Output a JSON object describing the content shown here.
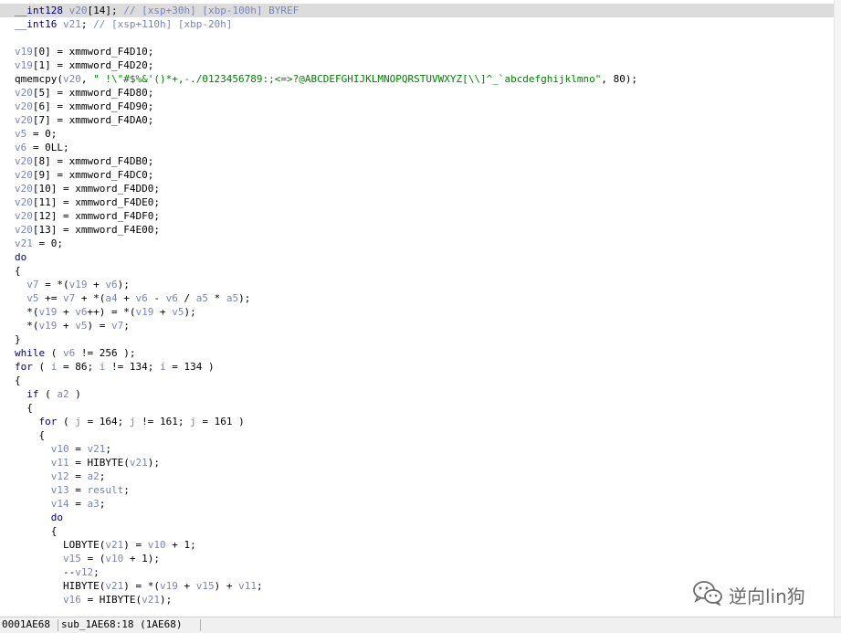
{
  "code_lines": [
    [
      [
        "__int128 ",
        "k"
      ],
      [
        "v20",
        "v"
      ],
      [
        "[14]; ",
        ""
      ],
      [
        "// [xsp+30h] [xbp-100h] BYREF",
        "c"
      ]
    ],
    [
      [
        "__int16 ",
        "k"
      ],
      [
        "v21",
        "v"
      ],
      [
        "; ",
        ""
      ],
      [
        "// [xsp+110h] [xbp-20h]",
        "c"
      ]
    ],
    [],
    [
      [
        "v19",
        "v"
      ],
      [
        "[0] = xmmword_F4D10;",
        ""
      ]
    ],
    [
      [
        "v19",
        "v"
      ],
      [
        "[1] = xmmword_F4D20;",
        ""
      ]
    ],
    [
      [
        "qmemcpy(",
        ""
      ],
      [
        "v20",
        "v"
      ],
      [
        ", ",
        ""
      ],
      [
        "\" !\\\"#$%&'()*+,-./0123456789:;<=>?@ABCDEFGHIJKLMNOPQRSTUVWXYZ[\\\\]^_`abcdefghijklmno\"",
        "str"
      ],
      [
        ", 80);",
        ""
      ]
    ],
    [
      [
        "v20",
        "v"
      ],
      [
        "[5] = xmmword_F4D80;",
        ""
      ]
    ],
    [
      [
        "v20",
        "v"
      ],
      [
        "[6] = xmmword_F4D90;",
        ""
      ]
    ],
    [
      [
        "v20",
        "v"
      ],
      [
        "[7] = xmmword_F4DA0;",
        ""
      ]
    ],
    [
      [
        "v5",
        "v"
      ],
      [
        " = 0;",
        ""
      ]
    ],
    [
      [
        "v6",
        "v"
      ],
      [
        " = 0LL;",
        ""
      ]
    ],
    [
      [
        "v20",
        "v"
      ],
      [
        "[8] = xmmword_F4DB0;",
        ""
      ]
    ],
    [
      [
        "v20",
        "v"
      ],
      [
        "[9] = xmmword_F4DC0;",
        ""
      ]
    ],
    [
      [
        "v20",
        "v"
      ],
      [
        "[10] = xmmword_F4DD0;",
        ""
      ]
    ],
    [
      [
        "v20",
        "v"
      ],
      [
        "[11] = xmmword_F4DE0;",
        ""
      ]
    ],
    [
      [
        "v20",
        "v"
      ],
      [
        "[12] = xmmword_F4DF0;",
        ""
      ]
    ],
    [
      [
        "v20",
        "v"
      ],
      [
        "[13] = xmmword_F4E00;",
        ""
      ]
    ],
    [
      [
        "v21",
        "v"
      ],
      [
        " = 0;",
        ""
      ]
    ],
    [
      [
        "do",
        "k"
      ]
    ],
    [
      [
        "{",
        ""
      ]
    ],
    [
      [
        "  ",
        ""
      ],
      [
        "v7",
        "v"
      ],
      [
        " = *(",
        ""
      ],
      [
        "v19",
        "v"
      ],
      [
        " + ",
        ""
      ],
      [
        "v6",
        "v"
      ],
      [
        ");",
        ""
      ]
    ],
    [
      [
        "  ",
        ""
      ],
      [
        "v5",
        "v"
      ],
      [
        " += ",
        ""
      ],
      [
        "v7",
        "v"
      ],
      [
        " + *(",
        ""
      ],
      [
        "a4",
        "v"
      ],
      [
        " + ",
        ""
      ],
      [
        "v6",
        "v"
      ],
      [
        " - ",
        ""
      ],
      [
        "v6",
        "v"
      ],
      [
        " / ",
        ""
      ],
      [
        "a5",
        "v"
      ],
      [
        " * ",
        ""
      ],
      [
        "a5",
        "v"
      ],
      [
        ");",
        ""
      ]
    ],
    [
      [
        "  *(",
        ""
      ],
      [
        "v19",
        "v"
      ],
      [
        " + ",
        ""
      ],
      [
        "v6",
        "v"
      ],
      [
        "++) = *(",
        ""
      ],
      [
        "v19",
        "v"
      ],
      [
        " + ",
        ""
      ],
      [
        "v5",
        "v"
      ],
      [
        ");",
        ""
      ]
    ],
    [
      [
        "  *(",
        ""
      ],
      [
        "v19",
        "v"
      ],
      [
        " + ",
        ""
      ],
      [
        "v5",
        "v"
      ],
      [
        ") = ",
        ""
      ],
      [
        "v7",
        "v"
      ],
      [
        ";",
        ""
      ]
    ],
    [
      [
        "}",
        ""
      ]
    ],
    [
      [
        "while",
        "k"
      ],
      [
        " ( ",
        ""
      ],
      [
        "v6",
        "v"
      ],
      [
        " != 256 );",
        ""
      ]
    ],
    [
      [
        "for",
        "k"
      ],
      [
        " ( ",
        ""
      ],
      [
        "i",
        "v"
      ],
      [
        " = 86; ",
        ""
      ],
      [
        "i",
        "v"
      ],
      [
        " != 134; ",
        ""
      ],
      [
        "i",
        "v"
      ],
      [
        " = 134 )",
        ""
      ]
    ],
    [
      [
        "{",
        ""
      ]
    ],
    [
      [
        "  ",
        ""
      ],
      [
        "if",
        "k"
      ],
      [
        " ( ",
        ""
      ],
      [
        "a2",
        "v"
      ],
      [
        " )",
        ""
      ]
    ],
    [
      [
        "  {",
        ""
      ]
    ],
    [
      [
        "    ",
        ""
      ],
      [
        "for",
        "k"
      ],
      [
        " ( ",
        ""
      ],
      [
        "j",
        "v"
      ],
      [
        " = 164; ",
        ""
      ],
      [
        "j",
        "v"
      ],
      [
        " != 161; ",
        ""
      ],
      [
        "j",
        "v"
      ],
      [
        " = 161 )",
        ""
      ]
    ],
    [
      [
        "    {",
        ""
      ]
    ],
    [
      [
        "      ",
        ""
      ],
      [
        "v10",
        "v"
      ],
      [
        " = ",
        ""
      ],
      [
        "v21",
        "v"
      ],
      [
        ";",
        ""
      ]
    ],
    [
      [
        "      ",
        ""
      ],
      [
        "v11",
        "v"
      ],
      [
        " = HIBYTE(",
        ""
      ],
      [
        "v21",
        "v"
      ],
      [
        ");",
        ""
      ]
    ],
    [
      [
        "      ",
        ""
      ],
      [
        "v12",
        "v"
      ],
      [
        " = ",
        ""
      ],
      [
        "a2",
        "v"
      ],
      [
        ";",
        ""
      ]
    ],
    [
      [
        "      ",
        ""
      ],
      [
        "v13",
        "v"
      ],
      [
        " = ",
        ""
      ],
      [
        "result",
        "v"
      ],
      [
        ";",
        ""
      ]
    ],
    [
      [
        "      ",
        ""
      ],
      [
        "v14",
        "v"
      ],
      [
        " = ",
        ""
      ],
      [
        "a3",
        "v"
      ],
      [
        ";",
        ""
      ]
    ],
    [
      [
        "      ",
        ""
      ],
      [
        "do",
        "k"
      ]
    ],
    [
      [
        "      {",
        ""
      ]
    ],
    [
      [
        "        LOBYTE(",
        ""
      ],
      [
        "v21",
        "v"
      ],
      [
        ") = ",
        ""
      ],
      [
        "v10",
        "v"
      ],
      [
        " + 1;",
        ""
      ]
    ],
    [
      [
        "        ",
        ""
      ],
      [
        "v15",
        "v"
      ],
      [
        " = (",
        ""
      ],
      [
        "v10",
        "v"
      ],
      [
        " + 1);",
        ""
      ]
    ],
    [
      [
        "        --",
        ""
      ],
      [
        "v12",
        "v"
      ],
      [
        ";",
        ""
      ]
    ],
    [
      [
        "        HIBYTE(",
        ""
      ],
      [
        "v21",
        "v"
      ],
      [
        ") = *(",
        ""
      ],
      [
        "v19",
        "v"
      ],
      [
        " + ",
        ""
      ],
      [
        "v15",
        "v"
      ],
      [
        ") + ",
        ""
      ],
      [
        "v11",
        "v"
      ],
      [
        ";",
        ""
      ]
    ],
    [
      [
        "        ",
        ""
      ],
      [
        "v16",
        "v"
      ],
      [
        " = HIBYTE(",
        ""
      ],
      [
        "v21",
        "v"
      ],
      [
        ");",
        ""
      ]
    ]
  ],
  "status_bar": {
    "address": "0001AE68",
    "location": "sub_1AE68:18 (1AE68)"
  },
  "watermark": {
    "icon": "wechat-icon",
    "text": "逆向lin狗"
  },
  "colors": {
    "keyword": "#00007f",
    "variable": "#7a84b8",
    "string": "#008000",
    "highlight_line": "#dcdcdc"
  }
}
